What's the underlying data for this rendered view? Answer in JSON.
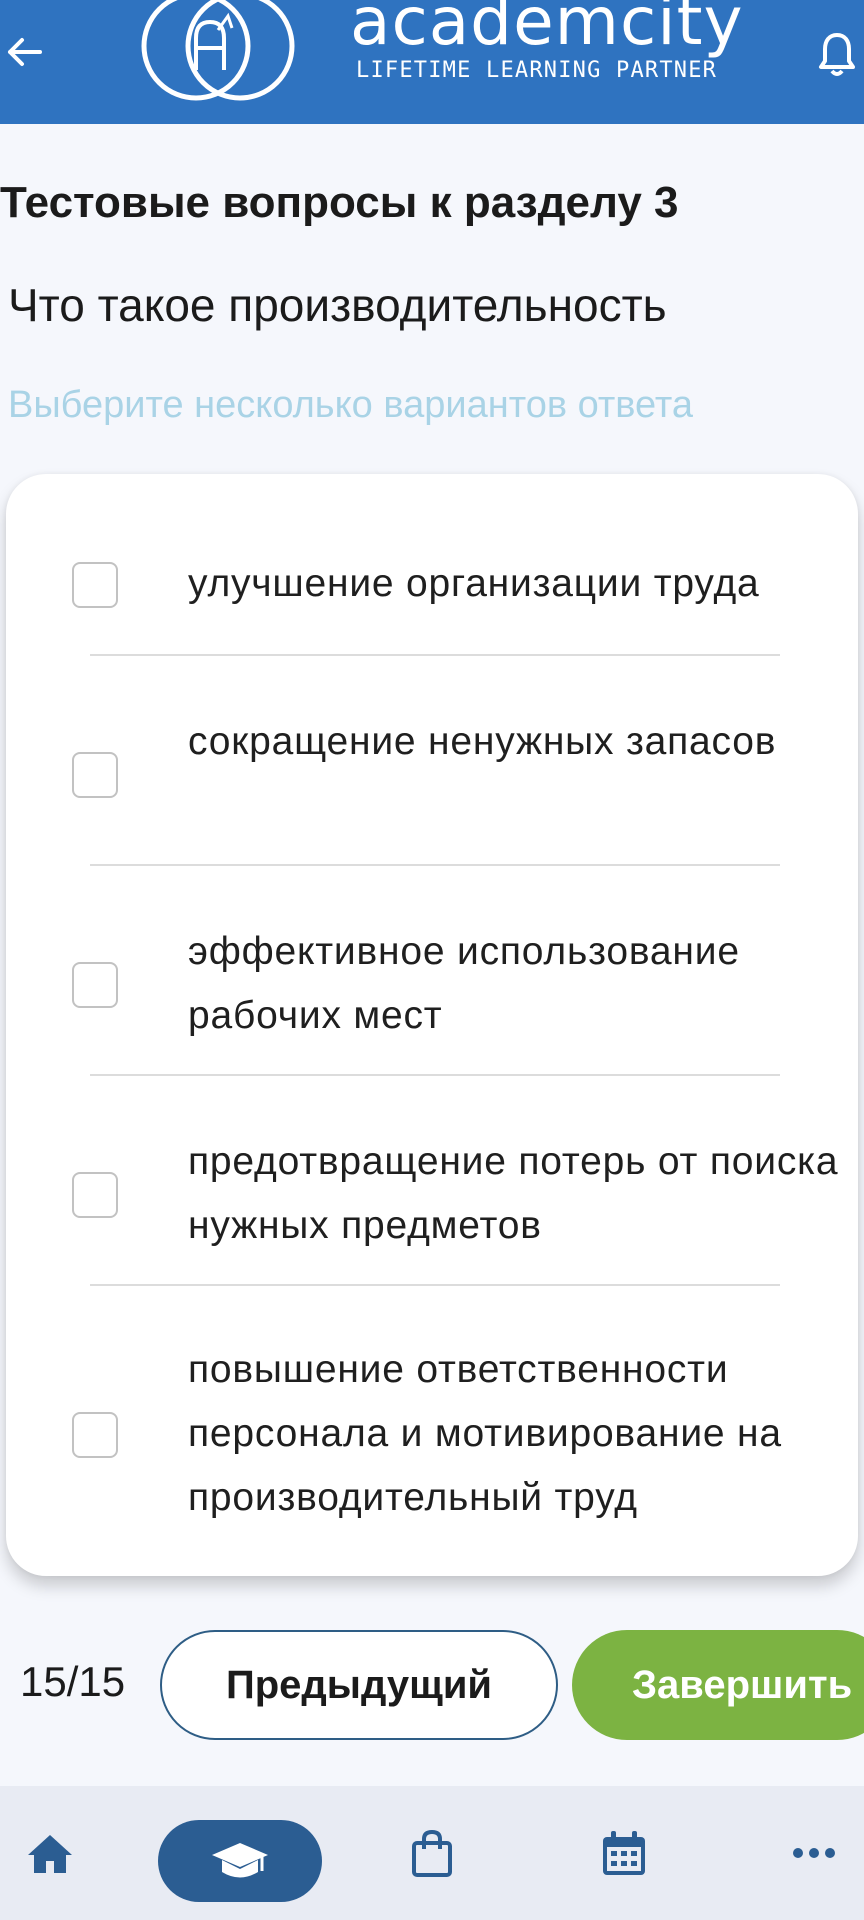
{
  "header": {
    "logo_word": "academcity",
    "logo_tagline": "LIFETIME LEARNING PARTNER",
    "back_icon": "arrow-left-icon",
    "bell_icon": "bell-icon",
    "color": "#2f73c0"
  },
  "section_title": "Тестовые вопросы к разделу 3",
  "question": "Что такое производительность",
  "hint": "Выберите несколько вариантов ответа",
  "options": [
    {
      "label": "улучшение организации труда",
      "checked": false
    },
    {
      "label": "сокращение ненужных запасов",
      "checked": false
    },
    {
      "label": "эффективное использование рабочих мест",
      "checked": false
    },
    {
      "label": "предотвращение потерь от поиска нужных предметов",
      "checked": false
    },
    {
      "label": "повышение ответственности персонала и мотивирование на производительный труд",
      "checked": false
    }
  ],
  "footer": {
    "counter": "15/15",
    "prev_label": "Предыдущий",
    "finish_label": "Завершить",
    "finish_color": "#7cb342"
  },
  "bottom_nav": {
    "items": [
      {
        "icon": "home-icon",
        "active": false
      },
      {
        "icon": "graduation-cap-icon",
        "active": true
      },
      {
        "icon": "shopping-bag-icon",
        "active": false
      },
      {
        "icon": "calendar-icon",
        "active": false
      },
      {
        "icon": "more-icon",
        "active": false
      }
    ],
    "active_color": "#2b5d92"
  }
}
